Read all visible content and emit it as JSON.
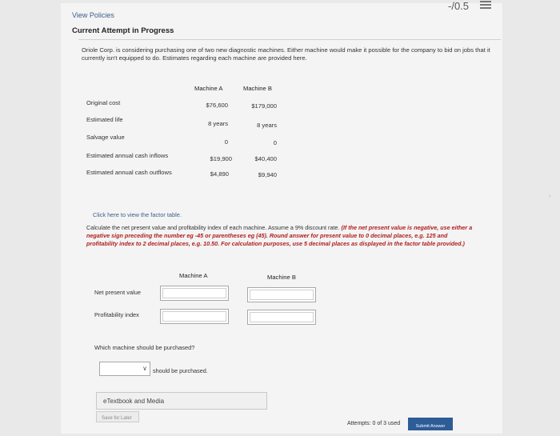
{
  "header": {
    "score": "-/0.5",
    "view_policies": "View Policies",
    "current_attempt": "Current Attempt in Progress"
  },
  "question": {
    "intro": "Oriole Corp. is considering purchasing one of two new diagnostic machines. Either machine would make it possible for the company to bid on jobs that it currently isn't equipped to do. Estimates regarding each machine are provided here.",
    "table": {
      "col_a": "Machine A",
      "col_b": "Machine B",
      "rows": [
        {
          "label": "Original cost",
          "a": "$76,600",
          "b": "$179,000"
        },
        {
          "label": "Estimated life",
          "a": "8 years",
          "b": "8 years"
        },
        {
          "label": "Salvage value",
          "a": "0",
          "b": "0"
        },
        {
          "label": "Estimated annual cash inflows",
          "a": "$19,900",
          "b": "$40,400"
        },
        {
          "label": "Estimated annual cash outflows",
          "a": "$4,890",
          "b": "$9,940"
        }
      ]
    },
    "factor_link": "Click here to view the factor table.",
    "instructions_plain": "Calculate the net present value and profitability index of each machine. Assume a 9% discount rate. ",
    "instructions_em": "(If the net present value is negative, use either a negative sign preceding the number eg -45 or parentheses eg (45). Round answer for present value to 0 decimal places, e.g. 125 and profitability index to 2 decimal places, e.g. 10.50. For calculation purposes, use 5 decimal places as displayed in the factor table provided.)"
  },
  "answers": {
    "col_a": "Machine A",
    "col_b": "Machine B",
    "npv_label": "Net present value",
    "pi_label": "Profitability index"
  },
  "purchase": {
    "question": "Which machine should be purchased?",
    "suffix": "should be purchased."
  },
  "footer": {
    "etextbook": "eTextbook and Media",
    "save_later": "Save for Later",
    "attempts": "Attempts: 0 of 3 used",
    "submit": "Submit Answer"
  }
}
